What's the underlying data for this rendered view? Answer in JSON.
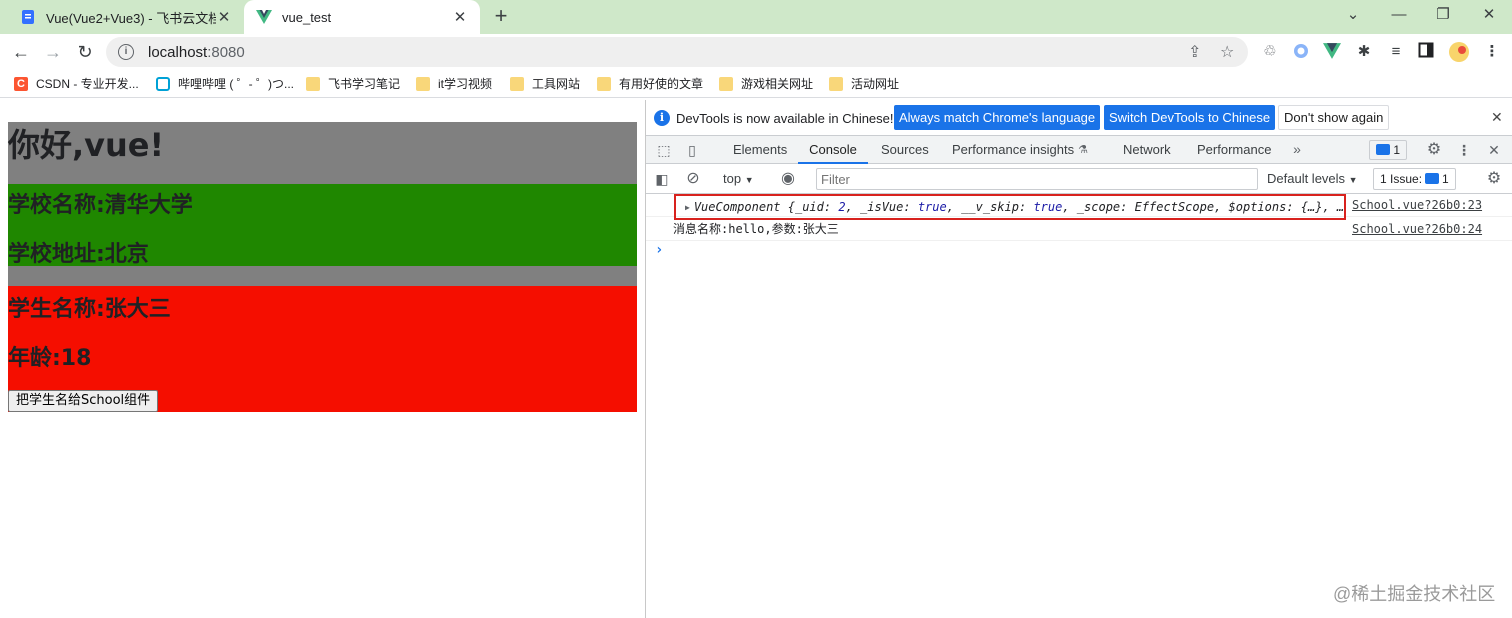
{
  "tabs": [
    {
      "title": "Vue(Vue2+Vue3) - 飞书云文档",
      "icon": "doc-icon",
      "active": false
    },
    {
      "title": "vue_test",
      "icon": "vue-logo-icon",
      "active": true
    }
  ],
  "address": {
    "host": "localhost",
    "port": ":8080"
  },
  "bookmarks": [
    {
      "label": "CSDN - 专业开发...",
      "icon": "csdn-icon"
    },
    {
      "label": "哔哩哔哩 ( ゜- ゜)つ...",
      "icon": "bilibili-icon"
    },
    {
      "label": "飞书学习笔记",
      "icon": "folder-icon"
    },
    {
      "label": "it学习视频",
      "icon": "folder-icon"
    },
    {
      "label": "工具网站",
      "icon": "folder-icon"
    },
    {
      "label": "有用好使的文章",
      "icon": "folder-icon"
    },
    {
      "label": "游戏相关网址",
      "icon": "folder-icon"
    },
    {
      "label": "活动网址",
      "icon": "folder-icon"
    }
  ],
  "page": {
    "greeting": "你好,vue!",
    "school_name": "学校名称:清华大学",
    "school_address": "学校地址:北京",
    "student_name": "学生名称:张大三",
    "student_age": "年龄:18",
    "send_button": "把学生名给School组件",
    "colors": {
      "app_bg": "#808080",
      "school_bg": "#1f8700",
      "student_bg": "#f50e00"
    }
  },
  "devtools": {
    "info": {
      "message": "DevTools is now available in Chinese!",
      "btn_match": "Always match Chrome's language",
      "btn_switch": "Switch DevTools to Chinese",
      "btn_dismiss": "Don't show again"
    },
    "tabs": [
      "Elements",
      "Console",
      "Sources",
      "Performance insights",
      "Network",
      "Performance"
    ],
    "active_tab": "Console",
    "message_badge": "1",
    "console_bar": {
      "context": "top",
      "filter_placeholder": "Filter",
      "levels": "Default levels",
      "issues_label": "1 Issue:",
      "issues_count": "1"
    },
    "logs": [
      {
        "type": "object",
        "name": "VueComponent",
        "preview": [
          {
            "k": "_uid: ",
            "v": "2"
          },
          {
            "k": ", _isVue: ",
            "v": "true"
          },
          {
            "k": ", __v_skip: ",
            "v": "true"
          },
          {
            "k": ", _scope: ",
            "v": "EffectScope"
          },
          {
            "k": ", $options: ",
            "v": "{…}"
          },
          {
            "k": ", ",
            "v": "…"
          }
        ],
        "source": "School.vue?26b0:23"
      },
      {
        "type": "text",
        "text": "消息名称:hello,参数:张大三",
        "source": "School.vue?26b0:24"
      }
    ]
  },
  "watermark": "@稀土掘金技术社区"
}
